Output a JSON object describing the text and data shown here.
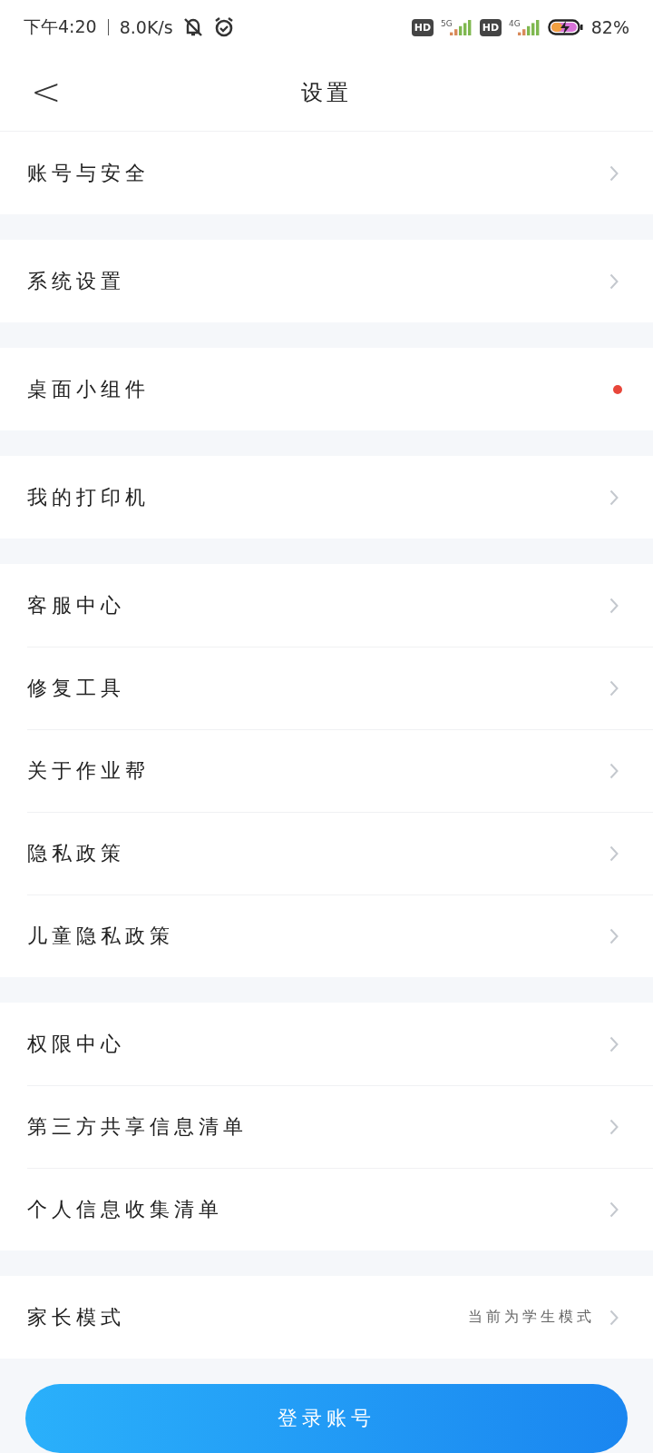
{
  "status_bar": {
    "time": "下午4:20",
    "net_speed": "8.0K/s",
    "sim_1": {
      "badge": "HD",
      "network": "5G"
    },
    "sim_2": {
      "badge": "HD",
      "network": "4G"
    },
    "battery": "82%"
  },
  "header": {
    "back": "<",
    "title": "设置"
  },
  "sections": [
    {
      "rows": [
        {
          "label": "账号与安全",
          "kind": "chevron"
        }
      ]
    },
    {
      "rows": [
        {
          "label": "系统设置",
          "kind": "chevron"
        }
      ]
    },
    {
      "rows": [
        {
          "label": "桌面小组件",
          "kind": "dot",
          "color": "#e8463a"
        }
      ]
    },
    {
      "rows": [
        {
          "label": "我的打印机",
          "kind": "chevron"
        }
      ]
    },
    {
      "rows": [
        {
          "label": "客服中心",
          "kind": "chevron"
        },
        {
          "label": "修复工具",
          "kind": "chevron"
        },
        {
          "label": "关于作业帮",
          "kind": "chevron"
        },
        {
          "label": "隐私政策",
          "kind": "chevron"
        },
        {
          "label": "儿童隐私政策",
          "kind": "chevron"
        }
      ]
    },
    {
      "rows": [
        {
          "label": "权限中心",
          "kind": "chevron"
        },
        {
          "label": "第三方共享信息清单",
          "kind": "chevron"
        },
        {
          "label": "个人信息收集清单",
          "kind": "chevron"
        }
      ]
    },
    {
      "rows": [
        {
          "label": "家长模式",
          "kind": "chevron",
          "value": "当前为学生模式"
        }
      ]
    }
  ],
  "login_button": "登录账号"
}
